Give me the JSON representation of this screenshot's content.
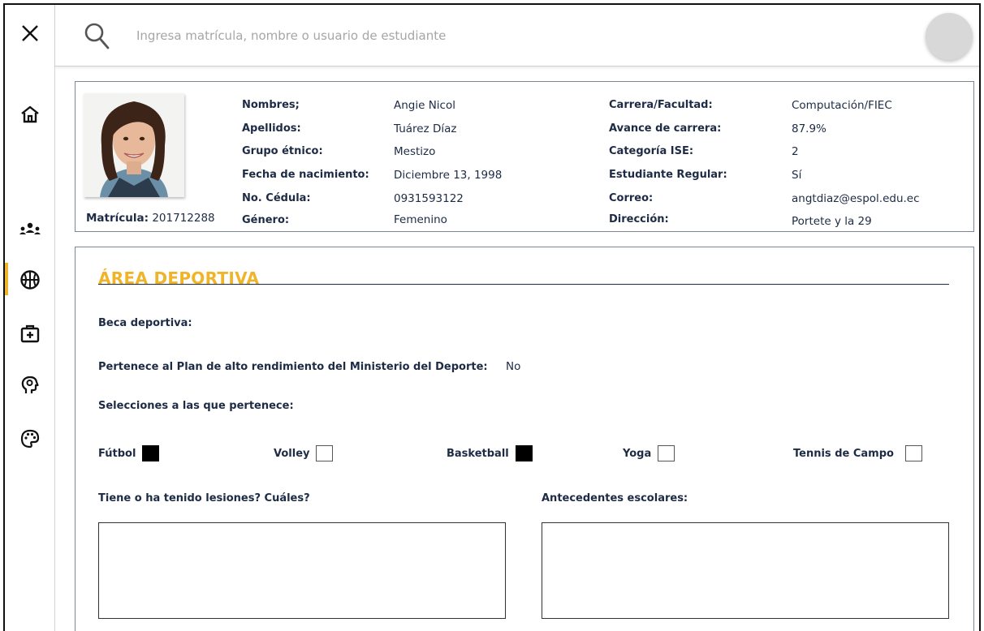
{
  "search": {
    "placeholder": "Ingresa matrícula, nombre o usuario de estudiante"
  },
  "sidebar": {
    "items": [
      {
        "icon": "home-icon"
      },
      {
        "icon": "group-icon"
      },
      {
        "icon": "basketball-icon",
        "active": true
      },
      {
        "icon": "medical-kit-icon"
      },
      {
        "icon": "head-gear-icon"
      },
      {
        "icon": "palette-icon"
      }
    ],
    "accent_color": "#f0b42a"
  },
  "student": {
    "matricula_label": "Matrícula:",
    "matricula_value": "201712288",
    "left_fields": [
      {
        "label": "Nombres;",
        "value": "Angie Nicol"
      },
      {
        "label": "Apellidos:",
        "value": "Tuárez Díaz"
      },
      {
        "label": "Grupo étnico:",
        "value": "Mestizo"
      },
      {
        "label": "Fecha de nacimiento:",
        "value": "Diciembre 13, 1998"
      },
      {
        "label": "No. Cédula:",
        "value": "0931593122"
      },
      {
        "label": "Género:",
        "value": "Femenino"
      }
    ],
    "right_fields": [
      {
        "label": "Carrera/Facultad:",
        "value": "Computación/FIEC"
      },
      {
        "label": "Avance de carrera:",
        "value": "87.9%"
      },
      {
        "label": "Categoría ISE:",
        "value": "2"
      },
      {
        "label": "Estudiante Regular:",
        "value": "Sí"
      },
      {
        "label": "Correo:",
        "value": "angtdiaz@espol.edu.ec"
      },
      {
        "label": "Dirección:",
        "value": "Portete y la 29"
      }
    ]
  },
  "sports": {
    "title": "ÁREA DEPORTIVA",
    "title_color": "#f0b42a",
    "beca_label": "Beca deportiva:",
    "plan_label": "Pertenece al Plan de alto rendimiento del Ministerio del Deporte:",
    "plan_value": "No",
    "selecciones_label": "Selecciones a las que pertenece:",
    "options": [
      {
        "label": "Fútbol",
        "checked": true
      },
      {
        "label": "Volley",
        "checked": false
      },
      {
        "label": "Basketball",
        "checked": true
      },
      {
        "label": "Yoga",
        "checked": false
      },
      {
        "label": "Tennis de Campo",
        "checked": false
      }
    ],
    "lesiones_label": "Tiene o ha tenido lesiones? Cuáles?",
    "antecedentes_label": "Antecedentes escolares:"
  }
}
